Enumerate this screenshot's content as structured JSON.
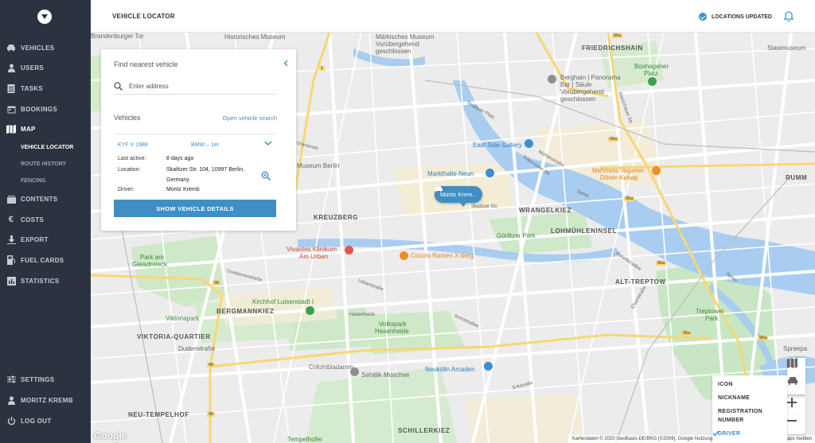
{
  "sidebar": {
    "items": [
      {
        "label": "VEHICLES",
        "icon": "car-icon"
      },
      {
        "label": "USERS",
        "icon": "user-icon"
      },
      {
        "label": "TASKS",
        "icon": "clipboard-icon"
      },
      {
        "label": "BOOKINGS",
        "icon": "calendar-icon"
      },
      {
        "label": "MAP",
        "icon": "map-icon"
      },
      {
        "label": "CONTENTS",
        "icon": "contents-icon"
      },
      {
        "label": "COSTS",
        "icon": "euro-icon"
      },
      {
        "label": "EXPORT",
        "icon": "download-icon"
      },
      {
        "label": "FUEL CARDS",
        "icon": "fuel-card-icon"
      },
      {
        "label": "STATISTICS",
        "icon": "chart-icon"
      }
    ],
    "map_sub": [
      "VEHICLE LOCATOR",
      "ROUTE HISTORY",
      "FENCING"
    ],
    "bottom": [
      {
        "label": "SETTINGS",
        "icon": "sliders-icon"
      },
      {
        "label": "MORITZ KREMB",
        "icon": "user-icon"
      },
      {
        "label": "LOG OUT",
        "icon": "power-icon"
      }
    ]
  },
  "header": {
    "title": "VEHICLE LOCATOR",
    "status": "LOCATIONS UPDATED"
  },
  "panel": {
    "heading": "Find nearest vehicle",
    "address_placeholder": "Enter address",
    "vehicles_label": "Vehicles",
    "open_search": "Open vehicle search",
    "vehicle": {
      "plate": "KYF V 1988",
      "model": "BMW – 1er",
      "last_active_label": "Last active:",
      "last_active": "8 days ago",
      "location_label": "Location:",
      "location_line1": "Skalitzer Str. 104, 10997 Berlin,",
      "location_line2": "Germany",
      "driver_label": "Driver:",
      "driver": "Moritz Kremb"
    },
    "details_button": "SHOW VEHICLE DETAILS"
  },
  "map": {
    "marker_label": "Moritz Krem..",
    "labels": {
      "friedrichshain": "FRIEDRICHSHAIN",
      "kreuzberg": "KREUZBERG",
      "wrangelkiez": "WRANGELKIEZ",
      "lohmuehleninsel": "LOHMÜHLENINSEL",
      "alt_treptow": "ALT-TREPTOW",
      "bergmannkiez": "BERGMANNKIEZ",
      "viktoria_quartier": "VIKTORIA-QUARTIER",
      "neu_tempelhof": "NEU-TEMPELHOF",
      "schillerkiez": "SCHILLERKIEZ",
      "rumm": "RUMM",
      "maerkisches_museum": "Märkisches Museum",
      "voruebergehend": "Vorübergehend",
      "geschlossen": "geschlossen",
      "historisches_museum": "Historisches Museum",
      "brandenburger": "Brandenburger Tor",
      "stasimuseum": "Stasimuseum",
      "boxhagener": "Boxhagener",
      "platz": "Platz",
      "berghain_1": "Berghain | Panorama",
      "berghain_2": "Bar | Säule",
      "berghain_3": "Vorübergehend",
      "berghain_4": "geschlossen",
      "east_side": "East Side Gallery",
      "markthalle": "Markthalle Neun",
      "mehmets_1": "Mehmets Veganer",
      "mehmets_2": "Döner-Kebap",
      "museum_berlin": "Museum Berlin",
      "goerlitzer": "Görlitzer Park",
      "park_am_1": "Park am",
      "park_am_2": "Gleisdreieck",
      "vivantes_1": "Vivantes Klinikum",
      "vivantes_2": "Am Urban",
      "cocolo": "Cocolo Ramen X-berg",
      "kirchhof": "Kirchhof Luisenstadt I",
      "viktoriapark": "Viktoriapark",
      "volkspark_1": "Volkspark",
      "volkspark_2": "Hasenheide",
      "treptower_1": "Treptower",
      "treptower_2": "Park",
      "sehitlik": "Sehitlik Moschee",
      "neukoelln": "Neukölln Arcaden",
      "tempelhofer": "Tempelhofer",
      "spreepa": "Spreepa",
      "skalitzer": "Skalitzer Str.",
      "kopenicker": "Köpenicker Str.",
      "muhlenstr": "Mühlenstraße",
      "spree": "Spree",
      "dudenstr": "Dudenstraße",
      "columbia": "Columbiadamm",
      "hasenheide": "Hasenheide",
      "urbanstr": "Urbanstraße",
      "gneisenau": "Gneisenaustraße",
      "sonnenallee": "Sonnenallee",
      "erkstr": "Erkstraße",
      "oranienstr": "Oranienstr.",
      "puschkinallee": "Puschkinallee",
      "elsenstr": "Elsenstraße",
      "warschauer": "Warschauer Str.",
      "stralauer": "Stralauer Platz",
      "b96a": "96a",
      "b1": "1",
      "b96": "96"
    },
    "google": "Google",
    "attribution": "Kartendaten © 2020 GeoBasis-DE/BKG (©2009), Google   Nutzungsbedingungen   Fehler bei Google Maps melden"
  },
  "label_menu": {
    "items": [
      "ICON",
      "NICKNAME",
      "REGISTRATION",
      "NUMBER",
      "DRIVER"
    ],
    "selected": "DRIVER"
  },
  "colors": {
    "sidebar_bg": "#2c3340",
    "accent": "#3f8fc4",
    "water": "#a8cdf0",
    "park": "#c8e6c3"
  }
}
